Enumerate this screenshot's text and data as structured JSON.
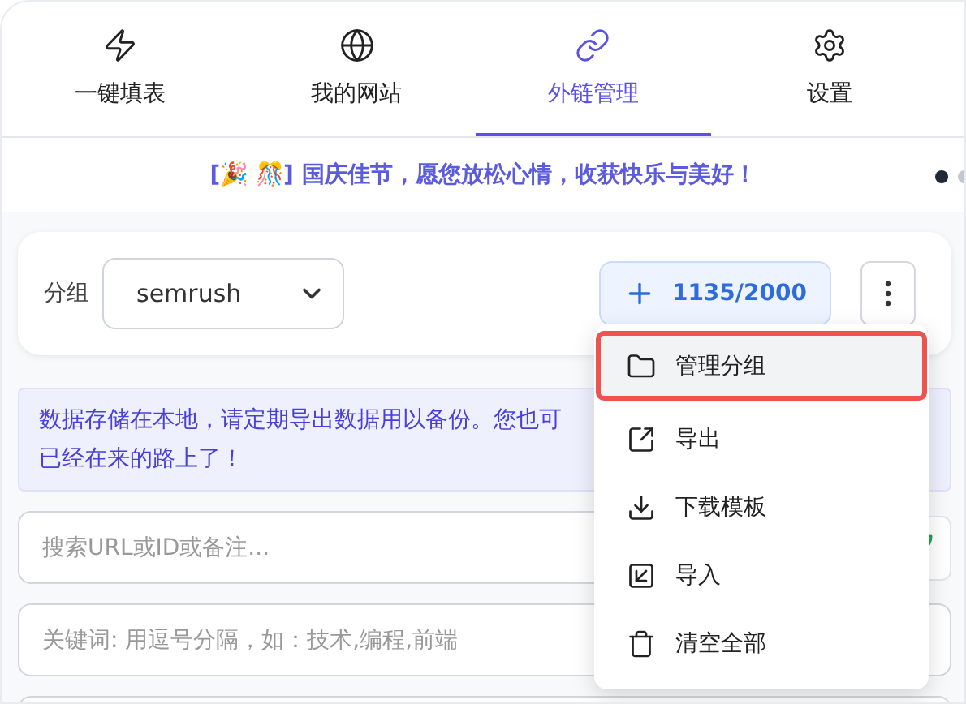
{
  "tabs": [
    {
      "label": "一键填表",
      "selected": false
    },
    {
      "label": "我的网站",
      "selected": false
    },
    {
      "label": "外链管理",
      "selected": true
    },
    {
      "label": "设置",
      "selected": false
    }
  ],
  "banner": {
    "text": "[🎉 🎊] 国庆佳节，愿您放松心情，收获快乐与美好！",
    "dots": [
      {
        "selected": true
      },
      {
        "selected": false
      }
    ]
  },
  "group": {
    "label": "分组",
    "value": "semrush",
    "count": "1135/2000"
  },
  "notice": [
    "数据存储在本地，请定期导出数据用以备份。您也可",
    "已经在来的路上了！"
  ],
  "search": {
    "placeholder": "搜索URL或ID或备注..."
  },
  "keywords": {
    "placeholder": "关键词: 用逗号分隔，如：技术,编程,前端"
  },
  "menu": [
    {
      "label": "管理分组",
      "highlighted": true
    },
    {
      "label": "导出",
      "highlighted": false
    },
    {
      "label": "下载模板",
      "highlighted": false
    },
    {
      "label": "导入",
      "highlighted": false
    },
    {
      "label": "清空全部",
      "highlighted": false
    }
  ]
}
